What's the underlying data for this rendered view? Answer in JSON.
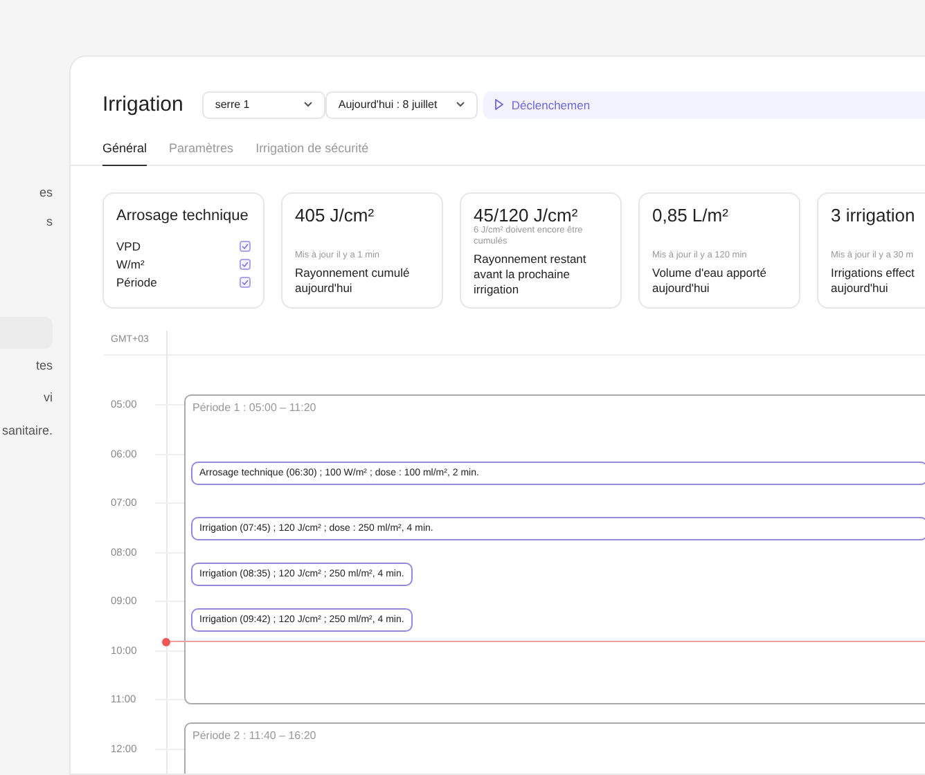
{
  "sidebar": {
    "items": [
      {
        "label": "es"
      },
      {
        "label": "s"
      },
      {
        "label": "tes"
      },
      {
        "label": "vi"
      },
      {
        "label": "sanitaire."
      }
    ]
  },
  "header": {
    "title": "Irrigation",
    "greenhouse_select": {
      "value": "serre 1"
    },
    "date_select": {
      "value": "Aujourd'hui : 8 juillet"
    },
    "trigger_button": {
      "label": "Déclenchemen"
    }
  },
  "tabs": [
    {
      "label": "Général",
      "selected": true
    },
    {
      "label": "Paramètres",
      "selected": false
    },
    {
      "label": "Irrigation de sécurité",
      "selected": false
    }
  ],
  "technical_card": {
    "title": "Arrosage technique",
    "options": [
      {
        "label": "VPD",
        "checked": true
      },
      {
        "label": "W/m²",
        "checked": true
      },
      {
        "label": "Période",
        "checked": true
      }
    ]
  },
  "stat_cards": [
    {
      "value": "405 J/cm²",
      "note": "Mis à jour il y a 1 min",
      "label": "Rayonnement cumulé aujourd'hui"
    },
    {
      "value": "45/120 J/cm²",
      "note": "6 J/cm² doivent encore être cumulés",
      "label": "Rayonnement restant avant la prochaine irrigation"
    },
    {
      "value": "0,85 L/m²",
      "note": "Mis à jour il y a 120 min",
      "label": "Volume d'eau apporté aujourd'hui"
    },
    {
      "value": "3 irrigation",
      "note": "Mis à jour il y a 30 m",
      "label": "Irrigations effect aujourd'hui"
    }
  ],
  "timeline": {
    "timezone": "GMT+03",
    "hours": [
      "05:00",
      "06:00",
      "07:00",
      "08:00",
      "09:00",
      "10:00",
      "11:00",
      "12:00"
    ],
    "periods": [
      {
        "label": "Période 1 : 05:00 – 11:20"
      },
      {
        "label": "Période 2 : 11:40 – 16:20"
      }
    ],
    "events": [
      {
        "label": "Arrosage technique (06:30) ; 100 W/m² ; dose : 100 ml/m², 2 min.",
        "kind": "wide"
      },
      {
        "label": "Irrigation (07:45) ; 120 J/cm² ; dose : 250 ml/m², 4 min.",
        "kind": "wide"
      },
      {
        "label": "Irrigation (08:35) ; 120 J/cm² ; 250 ml/m², 4 min.",
        "kind": "fit"
      },
      {
        "label": "Irrigation (09:42) ; 120 J/cm² ; 250 ml/m², 4 min.",
        "kind": "fit"
      }
    ]
  }
}
